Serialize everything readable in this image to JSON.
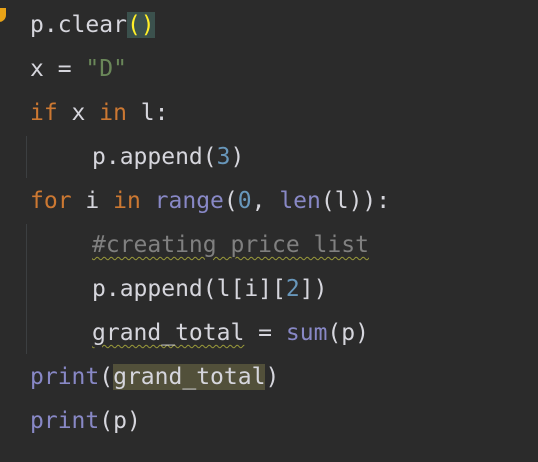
{
  "editor": {
    "line1": {
      "p_obj": "p.clear",
      "paren_open": "(",
      "paren_close": ")"
    },
    "line2": {
      "text": "x = ",
      "string": "\"D\""
    },
    "line3": {
      "kw_if": "if",
      "mid": " x ",
      "kw_in": "in",
      "rest": " l:"
    },
    "line4": {
      "text": "p.append(",
      "num": "3",
      "close": ")"
    },
    "line5": {
      "kw_for": "for",
      "var": " i ",
      "kw_in": "in",
      "space": " ",
      "range": "range",
      "open": "(",
      "num": "0",
      "comma": ", ",
      "len": "len",
      "rest": "(l)):"
    },
    "line6": {
      "comment": "#creating price list"
    },
    "line7": {
      "text": "p.append(l[i][",
      "num": "2",
      "close": "])"
    },
    "line8": {
      "var": "grand_total",
      "eq": " = ",
      "sum": "sum",
      "rest": "(p)"
    },
    "line9": {
      "print": "print",
      "open": "(",
      "arg": "grand_total",
      "close": ")"
    },
    "line10": {
      "print": "print",
      "rest": "(p)"
    }
  },
  "colors": {
    "background": "#2b2b2b",
    "keyword": "#cc7832",
    "builtin": "#8888c6",
    "string": "#6a8759",
    "number": "#6897bb",
    "comment": "#808080"
  },
  "icons": {
    "gutter": "intention-bulb-icon"
  }
}
